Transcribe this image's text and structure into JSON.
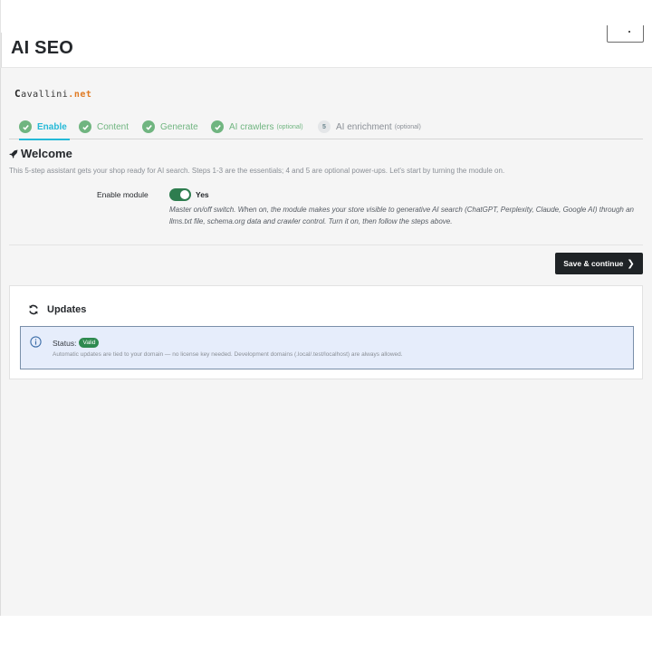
{
  "header": {
    "title": "AI SEO"
  },
  "brand": {
    "logo_prefix": "C",
    "logo_middle": "avallini",
    "logo_suffix": ".net"
  },
  "steps": [
    {
      "label": "Enable",
      "optional": "",
      "state": "active"
    },
    {
      "label": "Content",
      "optional": "",
      "state": "done"
    },
    {
      "label": "Generate",
      "optional": "",
      "state": "done"
    },
    {
      "label": "AI crawlers",
      "optional": "(optional)",
      "state": "done"
    },
    {
      "label": "AI enrichment",
      "optional": "(optional)",
      "state": "pending",
      "number": "5"
    }
  ],
  "welcome": {
    "title": "Welcome",
    "intro": "This 5-step assistant gets your shop ready for AI search. Steps 1-3 are the essentials; 4 and 5 are optional power-ups. Let's start by turning the module on."
  },
  "enable_module": {
    "label": "Enable module",
    "value_label": "Yes",
    "enabled": true,
    "help": "Master on/off switch. When on, the module makes your store visible to generative AI search (ChatGPT, Perplexity, Claude, Google AI) through an llms.txt file, schema.org data and crawler control. Turn it on, then follow the steps above."
  },
  "actions": {
    "save_label": "Save & continue"
  },
  "updates": {
    "title": "Updates",
    "status_label": "Status:",
    "status_badge": "Valid",
    "note": "Automatic updates are tied to your domain — no license key needed. Development domains (.local/.test/localhost) are always allowed."
  },
  "colors": {
    "accent": "#25b9d7",
    "done": "#70b580",
    "toggle_on": "#2e7d4f",
    "primary_button": "#1f2326",
    "valid_badge": "#2e8a4f",
    "alert_bg": "#e6edfb"
  }
}
